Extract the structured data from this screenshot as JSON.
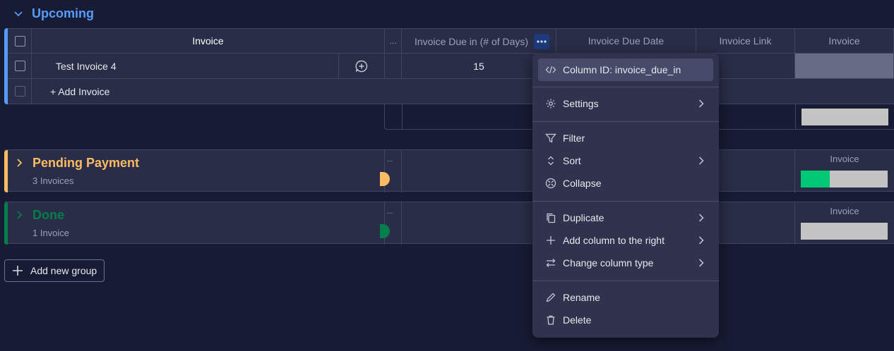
{
  "groups": [
    {
      "title": "Upcoming",
      "color": "#579bfc"
    },
    {
      "title": "Pending Payment",
      "count": "3 Invoices",
      "color": "#fdbc64"
    },
    {
      "title": "Done",
      "count": "1 Invoice",
      "color": "#037f4c"
    }
  ],
  "table": {
    "columns": {
      "item": "Invoice",
      "dots": "...",
      "due_in": "Invoice Due in (# of Days)",
      "due_date": "Invoice Due Date",
      "link": "Invoice Link",
      "invoice": "Invoice"
    },
    "rows": [
      {
        "name": "Test Invoice 4",
        "due_in": "15"
      }
    ],
    "add_item": "+ Add Invoice"
  },
  "summary_invoice_label": "Invoice",
  "summary_progress": {
    "pending_green_fraction": 0.33,
    "green_color": "#00c875",
    "gray_color": "#c4c4c4"
  },
  "add_group": "Add new group",
  "menu": {
    "column_id": "Column ID: invoice_due_in",
    "settings": "Settings",
    "filter": "Filter",
    "sort": "Sort",
    "collapse": "Collapse",
    "duplicate": "Duplicate",
    "add_column": "Add column to the right",
    "change_type": "Change column type",
    "rename": "Rename",
    "delete": "Delete"
  }
}
